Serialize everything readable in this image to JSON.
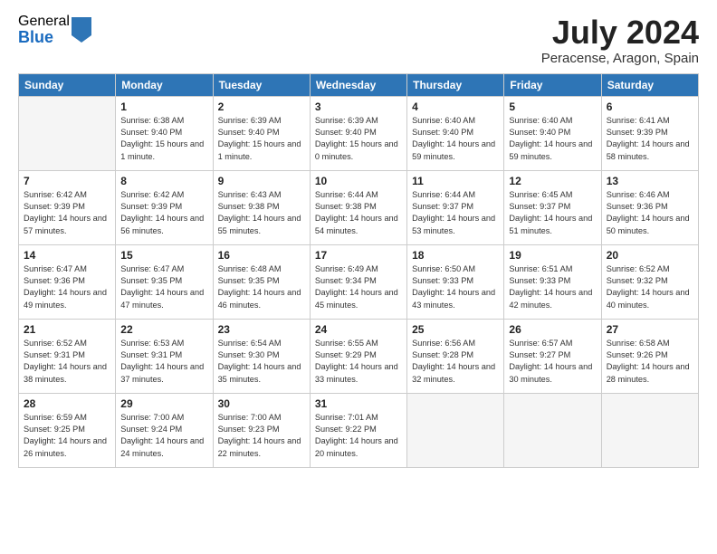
{
  "logo": {
    "general": "General",
    "blue": "Blue"
  },
  "title": "July 2024",
  "subtitle": "Peracense, Aragon, Spain",
  "headers": [
    "Sunday",
    "Monday",
    "Tuesday",
    "Wednesday",
    "Thursday",
    "Friday",
    "Saturday"
  ],
  "weeks": [
    [
      {
        "day": "",
        "sunrise": "",
        "sunset": "",
        "daylight": ""
      },
      {
        "day": "1",
        "sunrise": "Sunrise: 6:38 AM",
        "sunset": "Sunset: 9:40 PM",
        "daylight": "Daylight: 15 hours and 1 minute."
      },
      {
        "day": "2",
        "sunrise": "Sunrise: 6:39 AM",
        "sunset": "Sunset: 9:40 PM",
        "daylight": "Daylight: 15 hours and 1 minute."
      },
      {
        "day": "3",
        "sunrise": "Sunrise: 6:39 AM",
        "sunset": "Sunset: 9:40 PM",
        "daylight": "Daylight: 15 hours and 0 minutes."
      },
      {
        "day": "4",
        "sunrise": "Sunrise: 6:40 AM",
        "sunset": "Sunset: 9:40 PM",
        "daylight": "Daylight: 14 hours and 59 minutes."
      },
      {
        "day": "5",
        "sunrise": "Sunrise: 6:40 AM",
        "sunset": "Sunset: 9:40 PM",
        "daylight": "Daylight: 14 hours and 59 minutes."
      },
      {
        "day": "6",
        "sunrise": "Sunrise: 6:41 AM",
        "sunset": "Sunset: 9:39 PM",
        "daylight": "Daylight: 14 hours and 58 minutes."
      }
    ],
    [
      {
        "day": "7",
        "sunrise": "Sunrise: 6:42 AM",
        "sunset": "Sunset: 9:39 PM",
        "daylight": "Daylight: 14 hours and 57 minutes."
      },
      {
        "day": "8",
        "sunrise": "Sunrise: 6:42 AM",
        "sunset": "Sunset: 9:39 PM",
        "daylight": "Daylight: 14 hours and 56 minutes."
      },
      {
        "day": "9",
        "sunrise": "Sunrise: 6:43 AM",
        "sunset": "Sunset: 9:38 PM",
        "daylight": "Daylight: 14 hours and 55 minutes."
      },
      {
        "day": "10",
        "sunrise": "Sunrise: 6:44 AM",
        "sunset": "Sunset: 9:38 PM",
        "daylight": "Daylight: 14 hours and 54 minutes."
      },
      {
        "day": "11",
        "sunrise": "Sunrise: 6:44 AM",
        "sunset": "Sunset: 9:37 PM",
        "daylight": "Daylight: 14 hours and 53 minutes."
      },
      {
        "day": "12",
        "sunrise": "Sunrise: 6:45 AM",
        "sunset": "Sunset: 9:37 PM",
        "daylight": "Daylight: 14 hours and 51 minutes."
      },
      {
        "day": "13",
        "sunrise": "Sunrise: 6:46 AM",
        "sunset": "Sunset: 9:36 PM",
        "daylight": "Daylight: 14 hours and 50 minutes."
      }
    ],
    [
      {
        "day": "14",
        "sunrise": "Sunrise: 6:47 AM",
        "sunset": "Sunset: 9:36 PM",
        "daylight": "Daylight: 14 hours and 49 minutes."
      },
      {
        "day": "15",
        "sunrise": "Sunrise: 6:47 AM",
        "sunset": "Sunset: 9:35 PM",
        "daylight": "Daylight: 14 hours and 47 minutes."
      },
      {
        "day": "16",
        "sunrise": "Sunrise: 6:48 AM",
        "sunset": "Sunset: 9:35 PM",
        "daylight": "Daylight: 14 hours and 46 minutes."
      },
      {
        "day": "17",
        "sunrise": "Sunrise: 6:49 AM",
        "sunset": "Sunset: 9:34 PM",
        "daylight": "Daylight: 14 hours and 45 minutes."
      },
      {
        "day": "18",
        "sunrise": "Sunrise: 6:50 AM",
        "sunset": "Sunset: 9:33 PM",
        "daylight": "Daylight: 14 hours and 43 minutes."
      },
      {
        "day": "19",
        "sunrise": "Sunrise: 6:51 AM",
        "sunset": "Sunset: 9:33 PM",
        "daylight": "Daylight: 14 hours and 42 minutes."
      },
      {
        "day": "20",
        "sunrise": "Sunrise: 6:52 AM",
        "sunset": "Sunset: 9:32 PM",
        "daylight": "Daylight: 14 hours and 40 minutes."
      }
    ],
    [
      {
        "day": "21",
        "sunrise": "Sunrise: 6:52 AM",
        "sunset": "Sunset: 9:31 PM",
        "daylight": "Daylight: 14 hours and 38 minutes."
      },
      {
        "day": "22",
        "sunrise": "Sunrise: 6:53 AM",
        "sunset": "Sunset: 9:31 PM",
        "daylight": "Daylight: 14 hours and 37 minutes."
      },
      {
        "day": "23",
        "sunrise": "Sunrise: 6:54 AM",
        "sunset": "Sunset: 9:30 PM",
        "daylight": "Daylight: 14 hours and 35 minutes."
      },
      {
        "day": "24",
        "sunrise": "Sunrise: 6:55 AM",
        "sunset": "Sunset: 9:29 PM",
        "daylight": "Daylight: 14 hours and 33 minutes."
      },
      {
        "day": "25",
        "sunrise": "Sunrise: 6:56 AM",
        "sunset": "Sunset: 9:28 PM",
        "daylight": "Daylight: 14 hours and 32 minutes."
      },
      {
        "day": "26",
        "sunrise": "Sunrise: 6:57 AM",
        "sunset": "Sunset: 9:27 PM",
        "daylight": "Daylight: 14 hours and 30 minutes."
      },
      {
        "day": "27",
        "sunrise": "Sunrise: 6:58 AM",
        "sunset": "Sunset: 9:26 PM",
        "daylight": "Daylight: 14 hours and 28 minutes."
      }
    ],
    [
      {
        "day": "28",
        "sunrise": "Sunrise: 6:59 AM",
        "sunset": "Sunset: 9:25 PM",
        "daylight": "Daylight: 14 hours and 26 minutes."
      },
      {
        "day": "29",
        "sunrise": "Sunrise: 7:00 AM",
        "sunset": "Sunset: 9:24 PM",
        "daylight": "Daylight: 14 hours and 24 minutes."
      },
      {
        "day": "30",
        "sunrise": "Sunrise: 7:00 AM",
        "sunset": "Sunset: 9:23 PM",
        "daylight": "Daylight: 14 hours and 22 minutes."
      },
      {
        "day": "31",
        "sunrise": "Sunrise: 7:01 AM",
        "sunset": "Sunset: 9:22 PM",
        "daylight": "Daylight: 14 hours and 20 minutes."
      },
      {
        "day": "",
        "sunrise": "",
        "sunset": "",
        "daylight": ""
      },
      {
        "day": "",
        "sunrise": "",
        "sunset": "",
        "daylight": ""
      },
      {
        "day": "",
        "sunrise": "",
        "sunset": "",
        "daylight": ""
      }
    ]
  ]
}
